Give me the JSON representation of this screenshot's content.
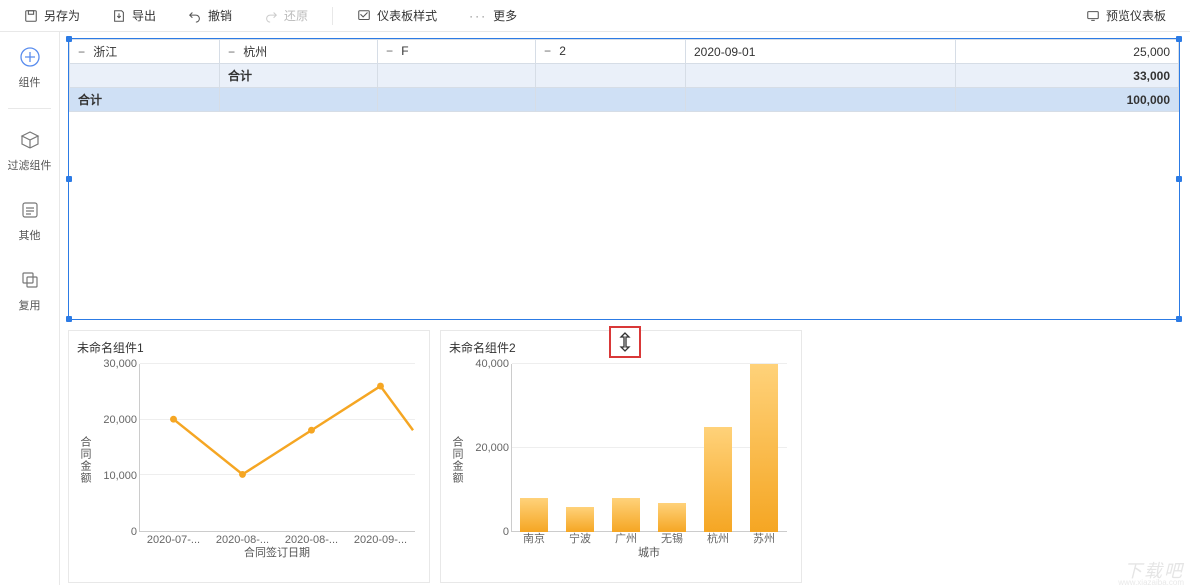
{
  "toolbar": {
    "save_as": "另存为",
    "export": "导出",
    "undo": "撤销",
    "redo": "还原",
    "dashboard_style": "仪表板样式",
    "more": "更多",
    "preview": "预览仪表板"
  },
  "sidebar": {
    "component": "组件",
    "filter_component": "过滤组件",
    "other": "其他",
    "reuse": "复用"
  },
  "table": {
    "rows": [
      {
        "province": "浙江",
        "city": "杭州",
        "col3": "F",
        "col4": "2",
        "date": "2020-09-01",
        "value": "25,000"
      }
    ],
    "subtotal_label": "合计",
    "subtotal_value": "33,000",
    "total_label": "合计",
    "total_value": "100,000"
  },
  "chart1": {
    "title": "未命名组件1",
    "ylabel": "合同金额",
    "xlabel": "合同签订日期"
  },
  "chart2": {
    "title": "未命名组件2",
    "ylabel": "合同金额",
    "xlabel": "城市"
  },
  "watermark": "下载吧",
  "watermark_url": "www.xiazaiba.com",
  "chart_data": [
    {
      "type": "line",
      "title": "未命名组件1",
      "xlabel": "合同签订日期",
      "ylabel": "合同金额",
      "ylim": [
        0,
        30000
      ],
      "categories": [
        "2020-07-...",
        "2020-08-...",
        "2020-08-...",
        "2020-09-..."
      ],
      "values": [
        20000,
        10000,
        18000,
        26000
      ],
      "trailing_partial_value": 18000
    },
    {
      "type": "bar",
      "title": "未命名组件2",
      "xlabel": "城市",
      "ylabel": "合同金额",
      "ylim": [
        0,
        40000
      ],
      "categories": [
        "南京",
        "宁波",
        "广州",
        "无锡",
        "杭州",
        "苏州"
      ],
      "values": [
        8000,
        6000,
        8000,
        7000,
        25000,
        40000
      ]
    }
  ]
}
